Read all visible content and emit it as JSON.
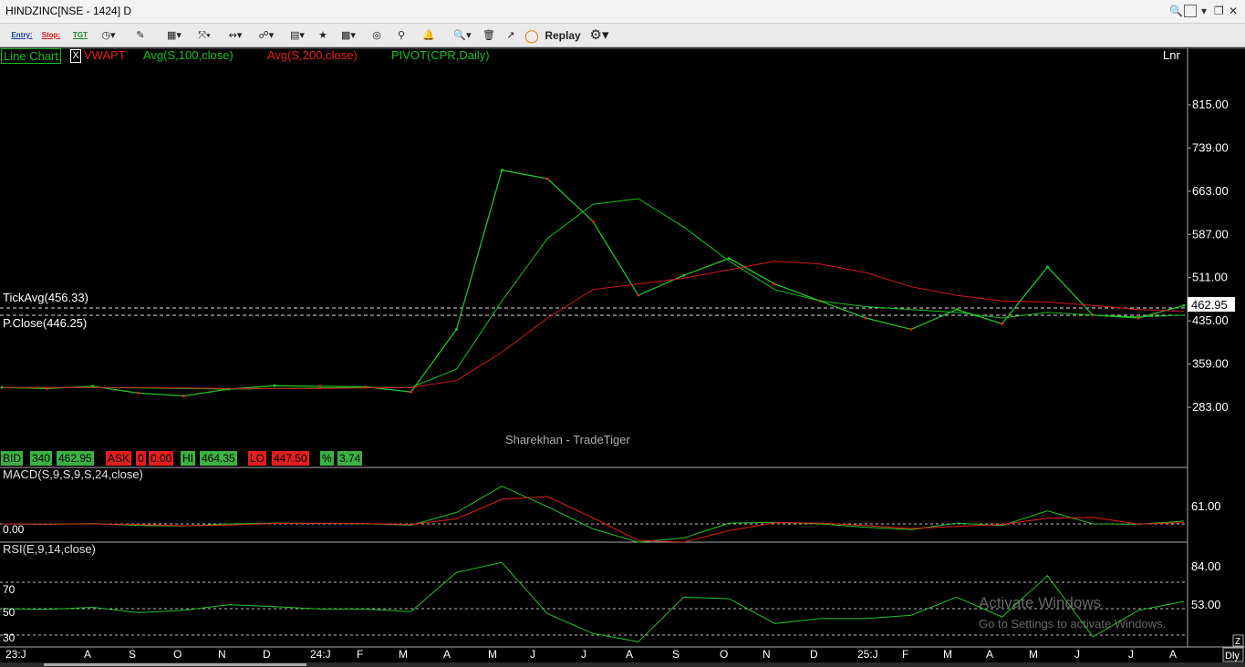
{
  "window": {
    "title": "HINDZINC[NSE - 1424] D"
  },
  "toolbar": {
    "entry_label": "Entry:",
    "stop_label": "Stop:",
    "tgt_label": "TGT",
    "replay_label": "Replay"
  },
  "legend": {
    "chart_type": "Line Chart",
    "close_box": "X",
    "vwap": "VWAPT",
    "avg100": "Avg(S,100,close)",
    "avg200": "Avg(S,200,close)",
    "pivot": "PIVOT(CPR,Daily)",
    "scale_mode": "Lnr"
  },
  "price_panel": {
    "tick_avg": "TickAvg(456.33)",
    "prev_close": "P.Close(446.25)",
    "last_price": "462.95",
    "watermark": "Sharekhan - TradeTiger",
    "y_ticks": [
      "815.00",
      "739.00",
      "663.00",
      "587.00",
      "511.00",
      "435.00",
      "359.00",
      "283.00"
    ]
  },
  "quote": {
    "bid_label": "BID",
    "bid_qty": "340",
    "bid_price": "462.95",
    "ask_label": "ASK",
    "ask_qty": "0",
    "ask_price": "0.00",
    "hi_label": "HI",
    "hi_value": "464.35",
    "lo_label": "LO",
    "lo_value": "447.50",
    "pct_label": "%",
    "pct_value": "3.74"
  },
  "macd_panel": {
    "title": "MACD(S,9,S,9,S,24,close)",
    "zero_label": "0.00",
    "y_tick": "61.00"
  },
  "rsi_panel": {
    "title": "RSI(E,9,14,close)",
    "y_ticks": [
      "84.00",
      "53.00"
    ],
    "levels": [
      "70",
      "50",
      "30"
    ]
  },
  "x_axis": {
    "labels": [
      "23:J",
      "A",
      "S",
      "O",
      "N",
      "D",
      "24:J",
      "F",
      "M",
      "A",
      "M",
      "J",
      "J",
      "A",
      "S",
      "O",
      "N",
      "D",
      "25:J",
      "F",
      "M",
      "A",
      "M",
      "J",
      "J",
      "A",
      "S"
    ],
    "period_button": "Dly"
  },
  "overlay": {
    "activate_title": "Activate Windows",
    "activate_sub": "Go to Settings to activate Windows."
  },
  "colors": {
    "up": "#22c12a",
    "down": "#e2231a",
    "avg100": "#19c020",
    "avg200": "#d4191c",
    "background": "#000000",
    "quote_green": "#3cb043",
    "quote_red": "#e21f1f"
  },
  "chart_data": {
    "type": "line",
    "title": "HINDZINC[NSE - 1424] D",
    "x": [
      "2023-07",
      "2023-08",
      "2023-09",
      "2023-10",
      "2023-11",
      "2023-12",
      "2024-01",
      "2024-02",
      "2024-03",
      "2024-04",
      "2024-05",
      "2024-06",
      "2024-07",
      "2024-08",
      "2024-09",
      "2024-10",
      "2024-11",
      "2024-12",
      "2025-01",
      "2025-02",
      "2025-03",
      "2025-04",
      "2025-05",
      "2025-06",
      "2025-07",
      "2025-08",
      "2025-09"
    ],
    "series": [
      {
        "name": "close",
        "values": [
          318,
          316,
          320,
          308,
          303,
          315,
          321,
          320,
          319,
          310,
          420,
          700,
          685,
          610,
          480,
          515,
          545,
          500,
          470,
          440,
          420,
          455,
          430,
          530,
          445,
          440,
          462
        ]
      },
      {
        "name": "Avg(S,100,close)",
        "values": [
          318,
          318,
          318,
          317,
          316,
          315,
          316,
          317,
          318,
          318,
          350,
          470,
          580,
          640,
          650,
          600,
          540,
          490,
          470,
          460,
          455,
          450,
          440,
          450,
          445,
          442,
          445
        ]
      },
      {
        "name": "Avg(S,200,close)",
        "values": [
          318,
          318,
          318,
          318,
          317,
          316,
          316,
          316,
          317,
          318,
          330,
          380,
          440,
          490,
          500,
          510,
          525,
          540,
          535,
          520,
          495,
          480,
          470,
          468,
          462,
          455,
          452
        ]
      }
    ],
    "ylim": [
      240,
      850
    ],
    "y_ticks": [
      815,
      739,
      663,
      587,
      511,
      435,
      359,
      283
    ],
    "reference_lines": {
      "tick_avg": 456.33,
      "prev_close": 446.25
    },
    "last": 462.95
  }
}
